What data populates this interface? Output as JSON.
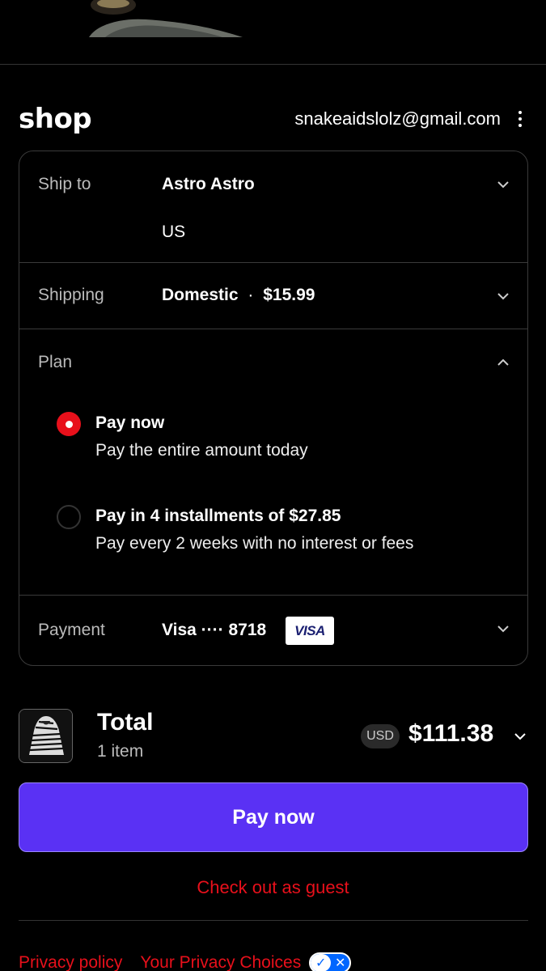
{
  "header": {
    "logo": "shop",
    "email": "snakeaidslolz@gmail.com"
  },
  "ship_to": {
    "label": "Ship to",
    "name": "Astro Astro",
    "country": "US"
  },
  "shipping": {
    "label": "Shipping",
    "method": "Domestic",
    "separator": "·",
    "price": "$15.99"
  },
  "plan": {
    "label": "Plan",
    "options": [
      {
        "title": "Pay now",
        "subtitle": "Pay the entire amount today",
        "selected": true
      },
      {
        "title": "Pay in 4 installments of $27.85",
        "subtitle": "Pay every 2 weeks with no interest or fees",
        "selected": false
      }
    ]
  },
  "payment": {
    "label": "Payment",
    "card": "Visa ···· 8718",
    "brand": "VISA"
  },
  "summary": {
    "total_label": "Total",
    "items": "1 item",
    "currency": "USD",
    "amount": "$111.38"
  },
  "actions": {
    "pay_now": "Pay now",
    "guest": "Check out as guest"
  },
  "footer": {
    "privacy_policy": "Privacy policy",
    "privacy_choices": "Your Privacy Choices"
  },
  "colors": {
    "accent": "#5a31f4",
    "link_red": "#e8101b",
    "background": "#000000"
  }
}
